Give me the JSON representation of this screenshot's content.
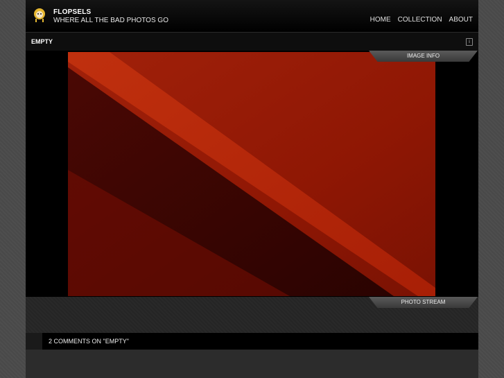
{
  "site": {
    "title": "FLOPSELS",
    "tagline": "WHERE ALL THE BAD PHOTOS GO",
    "logo_icon": "mascot-face-icon"
  },
  "nav": {
    "items": [
      {
        "label": "HOME"
      },
      {
        "label": "COLLECTION"
      },
      {
        "label": "ABOUT"
      }
    ]
  },
  "post": {
    "title": "EMPTY",
    "info_icon": "info-icon",
    "image_info_label": "IMAGE INFO",
    "photo_stream_label": "PHOTO STREAM",
    "comments_label": "2 COMMENTS ON \"EMPTY\""
  },
  "colors": {
    "photo_red": "#9a1a06",
    "photo_dark": "#3a0502",
    "background": "#4a4a4a"
  }
}
